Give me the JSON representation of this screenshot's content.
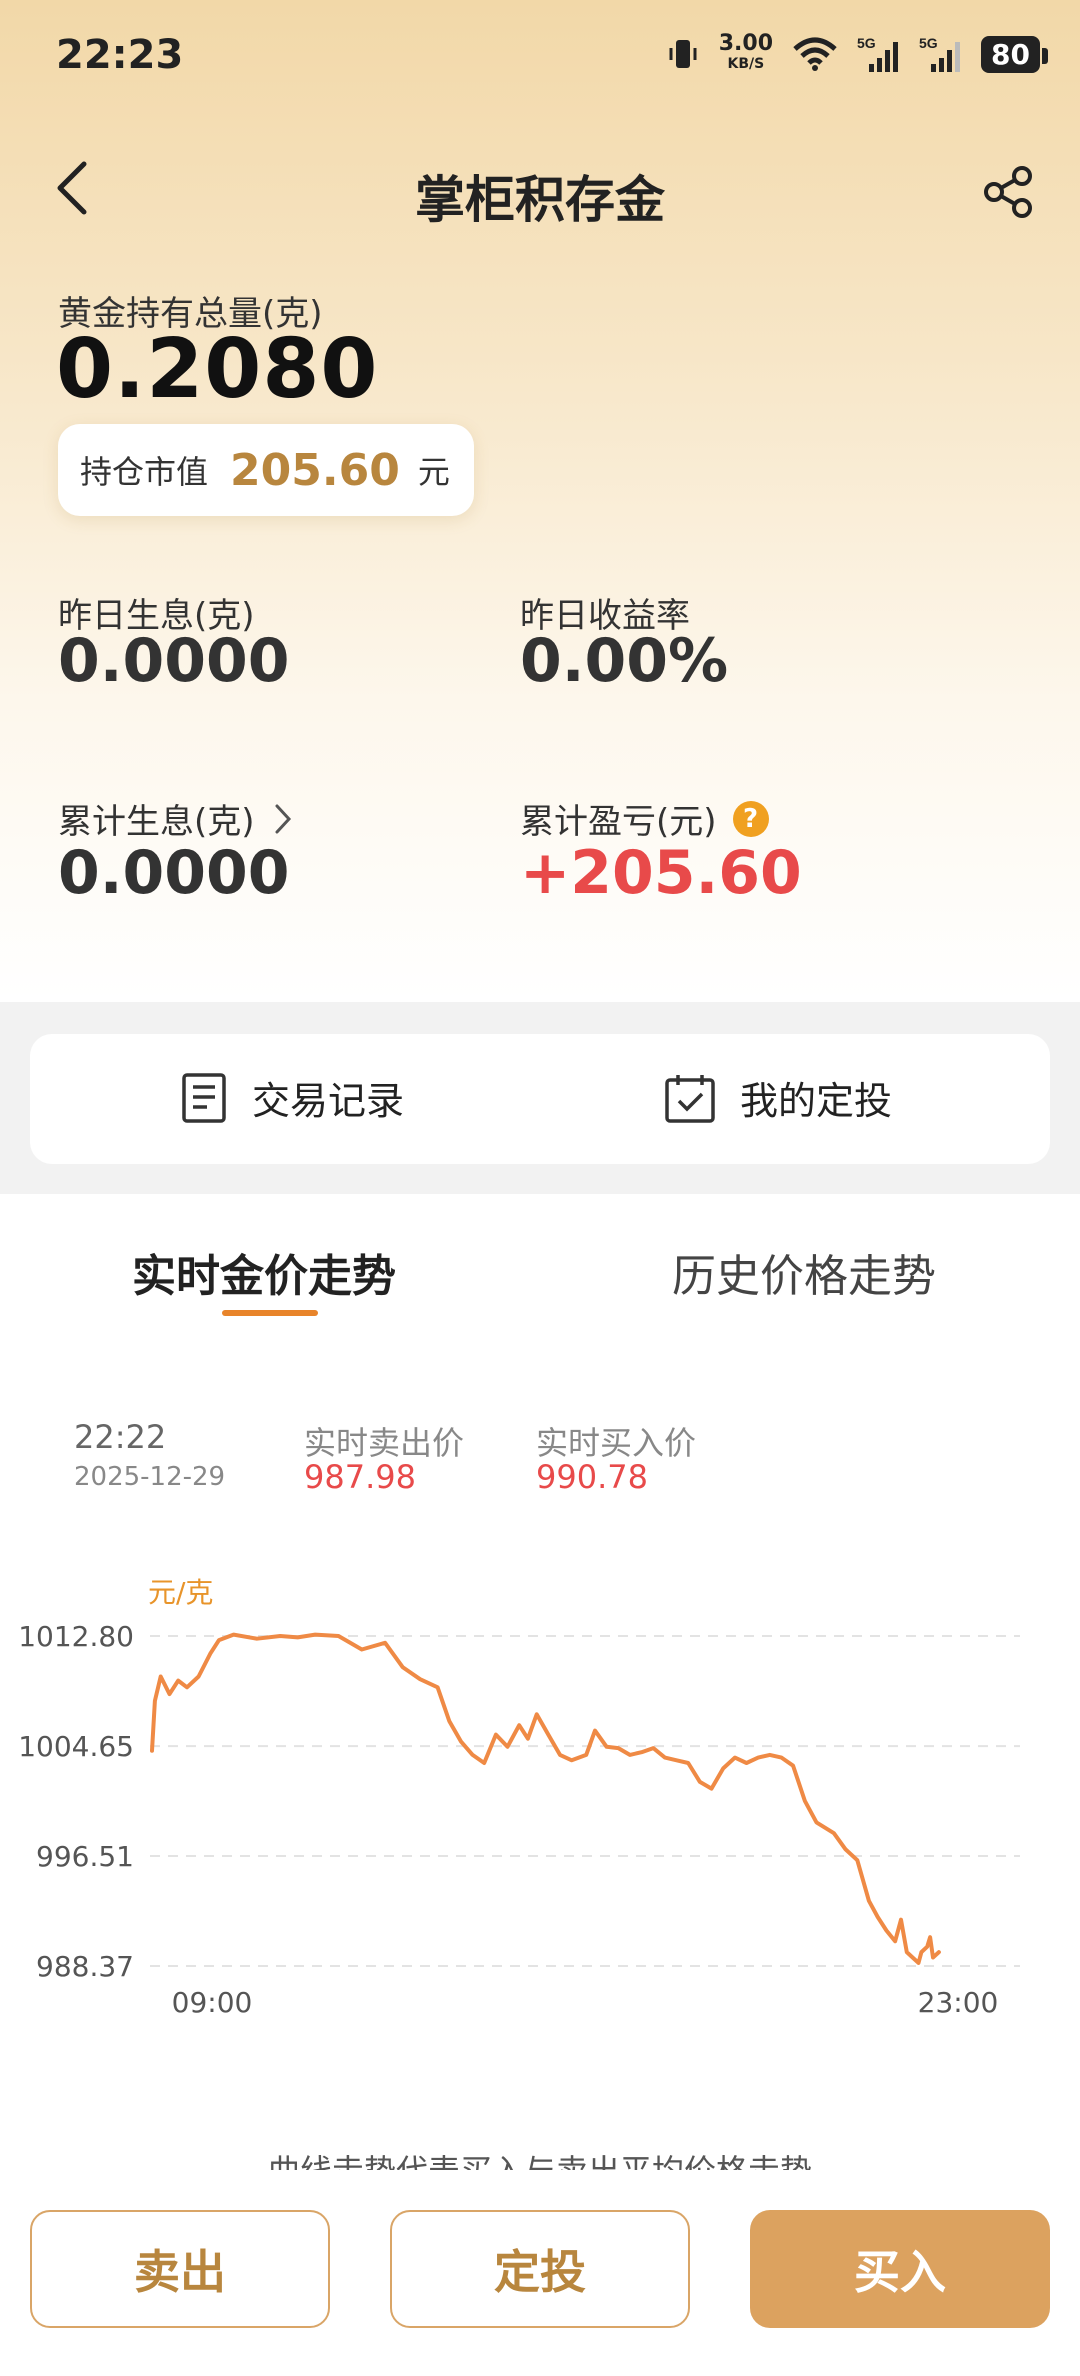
{
  "status_bar": {
    "time": "22:23",
    "net_speed": "3.00",
    "net_unit": "KB/S",
    "battery": "80",
    "icons": [
      "vibrate-icon",
      "wifi-icon",
      "signal-5g-icon",
      "signal-5g-icon",
      "battery-icon"
    ]
  },
  "nav": {
    "title": "掌柜积存金",
    "back_icon": "chevron-left-icon",
    "share_icon": "share-icon"
  },
  "holdings": {
    "total_label": "黄金持有总量(克)",
    "total_value": "0.2080",
    "market_value_label": "持仓市值",
    "market_value": "205.60",
    "market_value_unit": "元",
    "yesterday_interest_label": "昨日生息(克)",
    "yesterday_interest": "0.0000",
    "yesterday_yield_label": "昨日收益率",
    "yesterday_yield": "0.00%",
    "cumulative_interest_label": "累计生息(克)",
    "cumulative_interest": "0.0000",
    "cumulative_pl_label": "累计盈亏(元)",
    "cumulative_pl": "+205.60",
    "help_glyph": "?"
  },
  "quick_actions": {
    "transactions": "交易记录",
    "my_plan": "我的定投"
  },
  "tabs": {
    "realtime": "实时金价走势",
    "history": "历史价格走势"
  },
  "price_info": {
    "time": "22:22",
    "date": "2025-12-29",
    "sell_label": "实时卖出价",
    "sell_price": "987.98",
    "buy_label": "实时买入价",
    "buy_price": "990.78"
  },
  "chart_data": {
    "type": "line",
    "unit_label": "元/克",
    "y_ticks": [
      "1012.80",
      "1004.65",
      "996.51",
      "988.37"
    ],
    "ylim": [
      988.37,
      1012.8
    ],
    "x_ticks": [
      "09:00",
      "23:00"
    ],
    "x_range_hours": [
      9,
      23
    ],
    "grid": true,
    "color": "#ef8a45",
    "series": [
      {
        "x": [
          9.0,
          9.05,
          9.15,
          9.3,
          9.45,
          9.6,
          9.8,
          10.0,
          10.15,
          10.4,
          10.8,
          11.2,
          11.5,
          11.8,
          12.2,
          12.6,
          13.0,
          13.3,
          13.6,
          13.9,
          14.1,
          14.3,
          14.5,
          14.7,
          14.9,
          15.1,
          15.3,
          15.45,
          15.6,
          15.8,
          16.0,
          16.2,
          16.45,
          16.6,
          16.8,
          17.0,
          17.2,
          17.4,
          17.6,
          17.8,
          18.0,
          18.2,
          18.4,
          18.6,
          18.8,
          19.0,
          19.2,
          19.4,
          19.6,
          19.8,
          20.0,
          20.2,
          20.4,
          20.55,
          20.7,
          20.9,
          21.1,
          21.3,
          21.45,
          21.6,
          21.75,
          21.85,
          21.95,
          22.05,
          22.15,
          22.2,
          22.3,
          22.35,
          22.4,
          22.5
        ],
        "y": [
          1004.3,
          1008.0,
          1009.8,
          1008.5,
          1009.5,
          1009.0,
          1009.8,
          1011.5,
          1012.5,
          1012.9,
          1012.6,
          1012.8,
          1012.7,
          1012.9,
          1012.8,
          1011.8,
          1012.3,
          1010.5,
          1009.6,
          1009.0,
          1006.5,
          1005.0,
          1004.0,
          1003.4,
          1005.5,
          1004.6,
          1006.2,
          1005.2,
          1007.0,
          1005.5,
          1004.0,
          1003.6,
          1004.0,
          1005.8,
          1004.6,
          1004.5,
          1004.0,
          1004.2,
          1004.5,
          1003.8,
          1003.6,
          1003.4,
          1002.0,
          1001.5,
          1003.0,
          1003.8,
          1003.4,
          1003.8,
          1004.0,
          1003.8,
          1003.2,
          1000.6,
          999.0,
          998.6,
          998.2,
          997.0,
          996.2,
          993.2,
          992.0,
          991.0,
          990.2,
          991.8,
          989.4,
          989.0,
          988.6,
          989.4,
          989.8,
          990.5,
          989.0,
          989.4
        ]
      }
    ]
  },
  "footnote": "曲线走势代表买入与卖出平均价格走势",
  "bottom_buttons": {
    "sell": "卖出",
    "plan": "定投",
    "buy": "买入"
  }
}
